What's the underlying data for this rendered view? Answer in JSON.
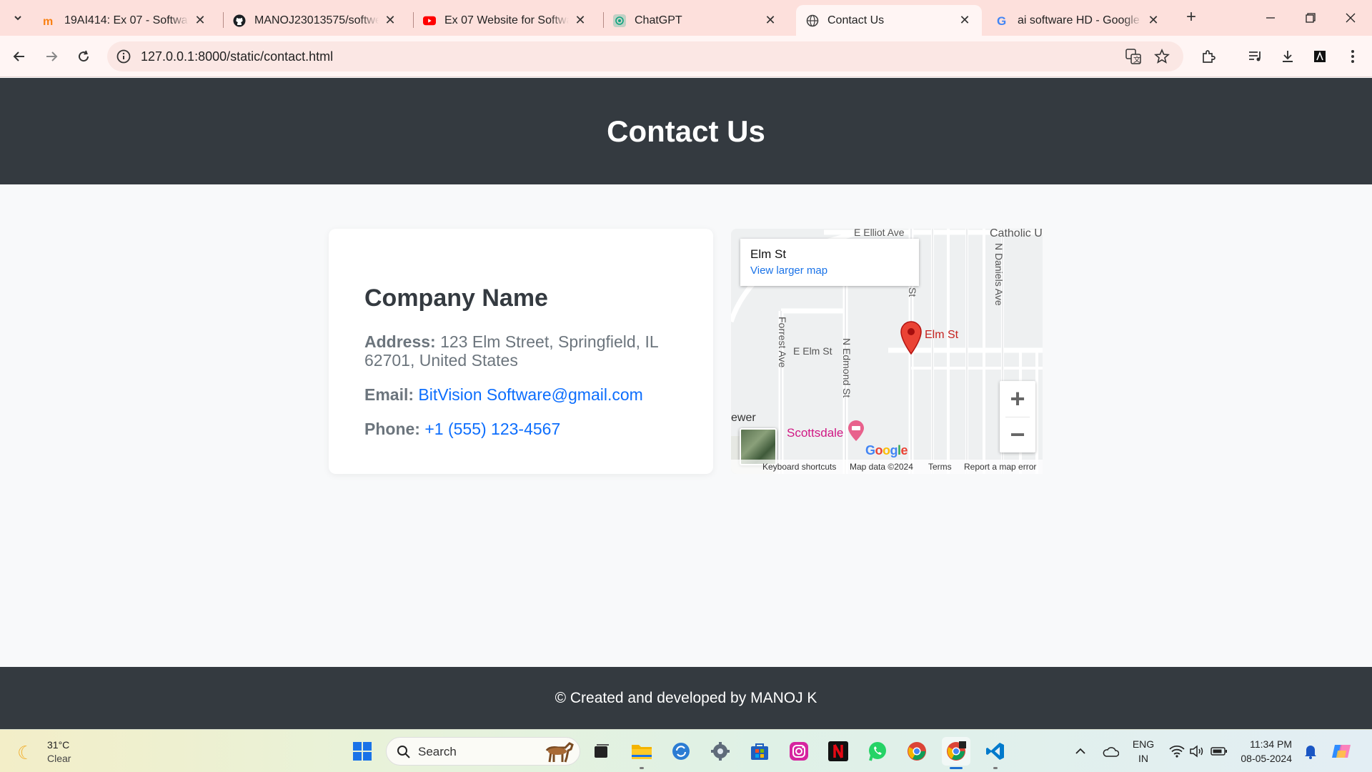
{
  "browser": {
    "tabs": [
      {
        "title": "19AI414: Ex 07 - Software D",
        "icon": "moodle-icon"
      },
      {
        "title": "MANOJ23013575/softweb",
        "icon": "github-icon"
      },
      {
        "title": "Ex 07 Website for Software",
        "icon": "youtube-icon"
      },
      {
        "title": "ChatGPT",
        "icon": "chatgpt-icon"
      },
      {
        "title": "Contact Us",
        "icon": "globe-icon"
      },
      {
        "title": "ai software HD - Google Se",
        "icon": "google-icon"
      }
    ],
    "active_tab": 4,
    "url": "127.0.0.1:8000/static/contact.html"
  },
  "page": {
    "header_title": "Contact Us",
    "company_name": "Company Name",
    "address_label": "Address:",
    "address_value": "123 Elm Street, Springfield, IL 62701, United States",
    "email_label": "Email:",
    "email_value": "BitVision Software@gmail.com",
    "phone_label": "Phone:",
    "phone_value": "+1 (555) 123-4567",
    "footer_text": "© Created and developed by MANOJ K"
  },
  "map": {
    "place": "Elm St",
    "view_larger": "View larger map",
    "pin_label": "Elm St",
    "streets": {
      "e_elliot": "E Elliot Ave",
      "catholic": "Catholic U",
      "n_daniels": "N Daniels Ave",
      "st": "St",
      "forrest": "Forrest Ave",
      "e_elm": "E Elm St",
      "n_edmond": "N Edmond St",
      "ewer": "ewer",
      "scottsdale": "Scottsdale"
    },
    "google": "Google",
    "attribution": {
      "shortcuts": "Keyboard shortcuts",
      "data": "Map data ©2024",
      "terms": "Terms",
      "report": "Report a map error"
    },
    "zoom_in": "+",
    "zoom_out": "−"
  },
  "taskbar": {
    "temperature": "31°C",
    "condition": "Clear",
    "search": "Search",
    "lang_top": "ENG",
    "lang_bottom": "IN",
    "time": "11:34 PM",
    "date": "08-05-2024"
  },
  "colors": {
    "header_bg": "#343a40",
    "link": "#0d6efd",
    "tabstrip": "#fde0dc"
  }
}
